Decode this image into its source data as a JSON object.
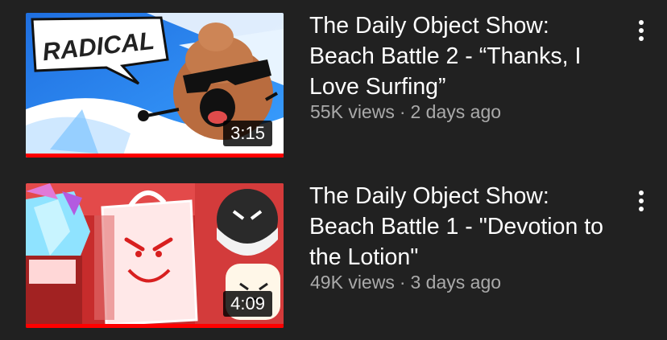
{
  "videos": [
    {
      "title": "The Daily Object Show: Beach Battle 2 - “Thanks, I Love Surfing”",
      "views": "55K views",
      "separator": "·",
      "age": "2 days ago",
      "duration": "3:15",
      "watch_progress": 1.0,
      "thumbnail_text": "RADICAL",
      "menu_icon": "more-vert-icon"
    },
    {
      "title": "The Daily Object Show: Beach Battle 1 - \"Devotion to the Lotion\"",
      "views": "49K views",
      "separator": "·",
      "age": "3 days ago",
      "duration": "4:09",
      "watch_progress": 1.0,
      "menu_icon": "more-vert-icon"
    }
  ],
  "colors": {
    "background": "#212121",
    "title": "#ffffff",
    "meta": "#aaaaaa",
    "progress": "#ff0000"
  }
}
